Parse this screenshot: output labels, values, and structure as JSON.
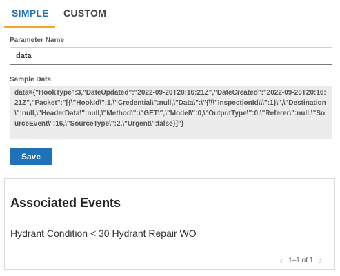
{
  "tabs": [
    {
      "label": "SIMPLE",
      "active": true
    },
    {
      "label": "CUSTOM",
      "active": false
    }
  ],
  "form": {
    "param_name_label": "Parameter Name",
    "param_name_value": "data",
    "sample_data_label": "Sample Data",
    "sample_data_value": "data={\"HookType\":3,\"DateUpdated\":\"2022-09-20T20:16:21Z\",\"DateCreated\":\"2022-09-20T20:16:21Z\",\"Packet\":\"[{\\\"HookId\\\":1,\\\"Credential\\\":null,\\\"Data\\\":\\\"{\\\\\\\"InspectionId\\\\\\\":1}\\\",\\\"Destination\\\":null,\\\"HeaderData\\\":null,\\\"Method\\\":\\\"GET\\\",\\\"Model\\\":0,\\\"OutputType\\\":0,\\\"Referer\\\":null,\\\"SourceEvent\\\":16,\\\"SourceType\\\":2,\\\"Urgent\\\":false}]\"}",
    "save_label": "Save"
  },
  "events": {
    "title": "Associated Events",
    "items": [
      "Hydrant Condition < 30 Hydrant Repair WO"
    ],
    "pagination": "1–1 of 1"
  },
  "colors": {
    "accent": "#1f72b8",
    "tab_underline": "#f5a623"
  },
  "icons": {
    "prev": "chevron-left-icon",
    "next": "chevron-right-icon"
  }
}
